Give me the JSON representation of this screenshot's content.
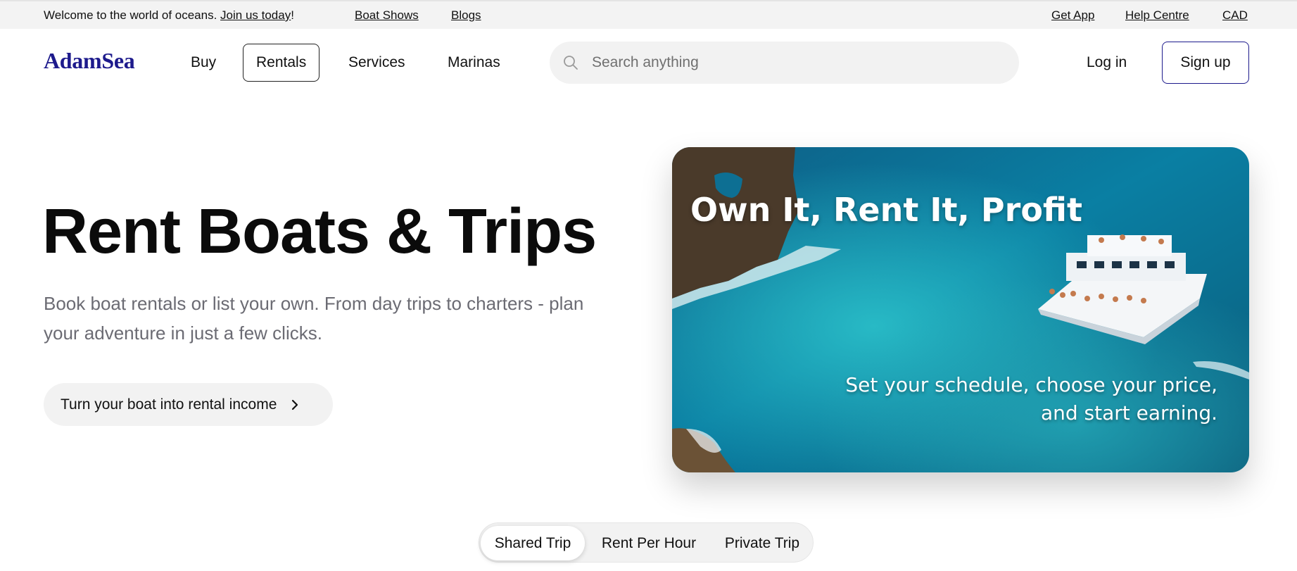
{
  "topbar": {
    "welcome_text": "Welcome to the world of oceans.",
    "join_link": "Join us today",
    "join_suffix": "!",
    "boat_shows": "Boat Shows",
    "blogs": "Blogs",
    "get_app": "Get App",
    "help_centre": "Help Centre",
    "currency": "CAD"
  },
  "header": {
    "logo": "AdamSea",
    "nav": [
      {
        "label": "Buy"
      },
      {
        "label": "Rentals",
        "active": true
      },
      {
        "label": "Services"
      },
      {
        "label": "Marinas"
      }
    ],
    "search_placeholder": "Search anything",
    "login": "Log in",
    "signup": "Sign up"
  },
  "hero": {
    "title": "Rent Boats & Trips",
    "subtitle": "Book boat rentals or list your own. From day trips to charters - plan your adventure in just a few clicks.",
    "cta_label": "Turn your boat into rental income",
    "card": {
      "headline": "Own It, Rent It, Profit",
      "tagline": "Set your schedule, choose your price, and start earning."
    }
  },
  "trip_tabs": [
    {
      "label": "Shared Trip",
      "selected": true
    },
    {
      "label": "Rent Per Hour",
      "selected": false
    },
    {
      "label": "Private Trip",
      "selected": false
    }
  ],
  "colors": {
    "brand": "#1d1a8c",
    "topbar_bg": "#f3f3f3",
    "muted_text": "#6b6b73",
    "pill_bg": "#f2f2f2"
  },
  "icons": {
    "search": "search-icon",
    "cta_arrow": "chevron-right-icon"
  }
}
